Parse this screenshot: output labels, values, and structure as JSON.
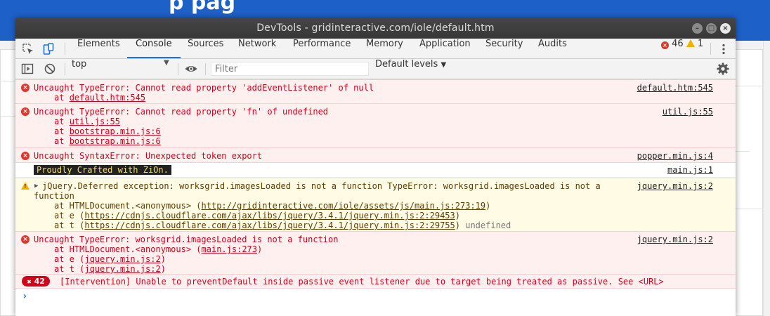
{
  "background_page": {
    "banner_text": "p   pag"
  },
  "window": {
    "title": "DevTools - gridinteractive.com/iole/default.htm"
  },
  "tabs": [
    {
      "label": "Elements"
    },
    {
      "label": "Console"
    },
    {
      "label": "Sources"
    },
    {
      "label": "Network"
    },
    {
      "label": "Performance"
    },
    {
      "label": "Memory"
    },
    {
      "label": "Application"
    },
    {
      "label": "Security"
    },
    {
      "label": "Audits"
    }
  ],
  "counters": {
    "errors": "46",
    "warnings": "1"
  },
  "filterbar": {
    "context": "top",
    "filter_placeholder": "Filter",
    "levels": "Default levels"
  },
  "colors": {
    "error": "#d0021b",
    "warning_bg": "#fffbe5",
    "accent": "#1a73e8"
  },
  "messages": [
    {
      "type": "error",
      "text": "Uncaught TypeError: Cannot read property 'addEventListener' of null",
      "source": "default.htm:545",
      "stack": [
        {
          "prefix": "at ",
          "link": "default.htm:545"
        }
      ]
    },
    {
      "type": "error",
      "text": "Uncaught TypeError: Cannot read property 'fn' of undefined",
      "source": "util.js:55",
      "stack": [
        {
          "prefix": "at ",
          "link": "util.js:55"
        },
        {
          "prefix": "at ",
          "link": "bootstrap.min.js:6"
        },
        {
          "prefix": "at ",
          "link": "bootstrap.min.js:6"
        }
      ]
    },
    {
      "type": "error",
      "text": "Uncaught SyntaxError: Unexpected token export",
      "source": "popper.min.js:4"
    },
    {
      "type": "log",
      "text": "Proudly Crafted with ZiOn.",
      "source": "main.js:1"
    },
    {
      "type": "warning",
      "text_line1": "jQuery.Deferred exception: worksgrid.imagesLoaded is not a function TypeError: worksgrid.imagesLoaded is not a",
      "text_line2": "function",
      "source": "jquery.min.js:2",
      "stack": [
        {
          "prefix": "at HTMLDocument.<anonymous> (",
          "link": "http://gridinteractive.com/iole/assets/js/main.js:273:19",
          "suffix": ")"
        },
        {
          "prefix": "at e (",
          "link": "https://cdnjs.cloudflare.com/ajax/libs/jquery/3.4.1/jquery.min.js:2:29453",
          "suffix": ")"
        },
        {
          "prefix": "at t (",
          "link": "https://cdnjs.cloudflare.com/ajax/libs/jquery/3.4.1/jquery.min.js:2:29755",
          "suffix": ")",
          "trailing": "undefined"
        }
      ]
    },
    {
      "type": "error",
      "text": "Uncaught TypeError: worksgrid.imagesLoaded is not a function",
      "source": "jquery.min.js:2",
      "stack": [
        {
          "prefix": "at HTMLDocument.<anonymous> (",
          "link": "main.js:273",
          "suffix": ")"
        },
        {
          "prefix": "at e (",
          "link": "jquery.min.js:2",
          "suffix": ")"
        },
        {
          "prefix": "at t (",
          "link": "jquery.min.js:2",
          "suffix": ")"
        }
      ]
    },
    {
      "type": "intervention",
      "count": "42",
      "text": "[Intervention] Unable to preventDefault inside passive event listener due to target being treated as passive. See <URL>"
    }
  ]
}
